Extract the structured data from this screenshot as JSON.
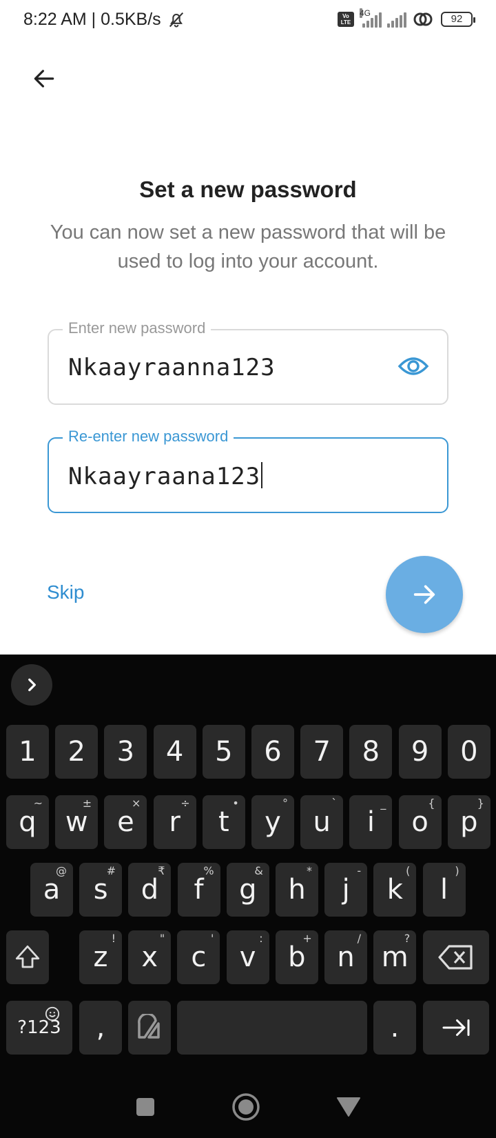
{
  "status": {
    "time_speed": "8:22 AM | 0.5KB/s",
    "network": "4G",
    "battery": "92",
    "volte": "Vo\nLTE"
  },
  "header": {
    "title": "Set a new password",
    "subtitle": "You can now set a new password that will be used to log into your account."
  },
  "fields": {
    "new_password": {
      "label": "Enter new password",
      "value": "Nkaayraanna123"
    },
    "confirm_password": {
      "label": "Re-enter new password",
      "value": "Nkaayraana123"
    }
  },
  "actions": {
    "skip": "Skip"
  },
  "keyboard": {
    "numbers": [
      "1",
      "2",
      "3",
      "4",
      "5",
      "6",
      "7",
      "8",
      "9",
      "0"
    ],
    "row1": [
      {
        "k": "q",
        "h": "~"
      },
      {
        "k": "w",
        "h": "±"
      },
      {
        "k": "e",
        "h": "×"
      },
      {
        "k": "r",
        "h": "÷"
      },
      {
        "k": "t",
        "h": "•"
      },
      {
        "k": "y",
        "h": "°"
      },
      {
        "k": "u",
        "h": "`"
      },
      {
        "k": "i",
        "h": "_"
      },
      {
        "k": "o",
        "h": "{"
      },
      {
        "k": "p",
        "h": "}"
      }
    ],
    "row2": [
      {
        "k": "a",
        "h": "@"
      },
      {
        "k": "s",
        "h": "#"
      },
      {
        "k": "d",
        "h": "₹"
      },
      {
        "k": "f",
        "h": "%"
      },
      {
        "k": "g",
        "h": "&"
      },
      {
        "k": "h",
        "h": "*"
      },
      {
        "k": "j",
        "h": "-"
      },
      {
        "k": "k",
        "h": "("
      },
      {
        "k": "l",
        "h": ")"
      }
    ],
    "row3": [
      {
        "k": "z",
        "h": "!"
      },
      {
        "k": "x",
        "h": "\""
      },
      {
        "k": "c",
        "h": "'"
      },
      {
        "k": "v",
        "h": ":"
      },
      {
        "k": "b",
        "h": "+"
      },
      {
        "k": "n",
        "h": "/"
      },
      {
        "k": "m",
        "h": "?"
      }
    ],
    "symbols_label": "?123",
    "comma": ",",
    "period": "."
  }
}
